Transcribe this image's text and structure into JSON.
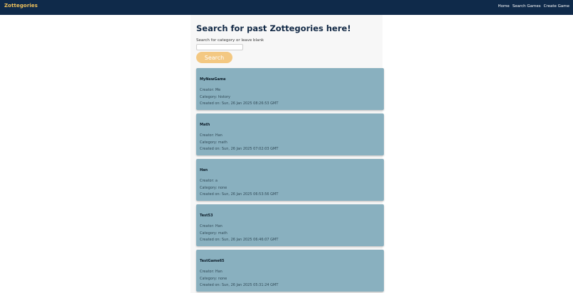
{
  "nav": {
    "brand": "Zottegories",
    "links": [
      "Home",
      "Search Games",
      "Create Game"
    ]
  },
  "main": {
    "title": "Search for past Zottegories here!",
    "search_label": "Search for category or leave blank",
    "search_input_value": "",
    "search_button": "Search"
  },
  "games": [
    {
      "title": "MyNewGame",
      "creator": "Creator: Me",
      "category": "Category: history",
      "created": "Created on: Sun, 26 Jan 2025 08:26:53 GMT"
    },
    {
      "title": "Math",
      "creator": "Creator: Han",
      "category": "Category: math",
      "created": "Created on: Sun, 26 Jan 2025 07:02:03 GMT"
    },
    {
      "title": "Han",
      "creator": "Creator: a",
      "category": "Category: none",
      "created": "Created on: Sun, 26 Jan 2025 06:53:56 GMT"
    },
    {
      "title": "Test53",
      "creator": "Creator: Han",
      "category": "Category: math",
      "created": "Created on: Sun, 26 Jan 2025 06:46:07 GMT"
    },
    {
      "title": "TestGame65",
      "creator": "Creator: Han",
      "category": "Category: none",
      "created": "Created on: Sun, 26 Jan 2025 05:31:24 GMT"
    }
  ],
  "colors": {
    "navbar": "#0f2a4a",
    "brand": "#f3c45c",
    "card": "#89b0bf",
    "search_button": "#f3c882",
    "title": "#132a46"
  }
}
